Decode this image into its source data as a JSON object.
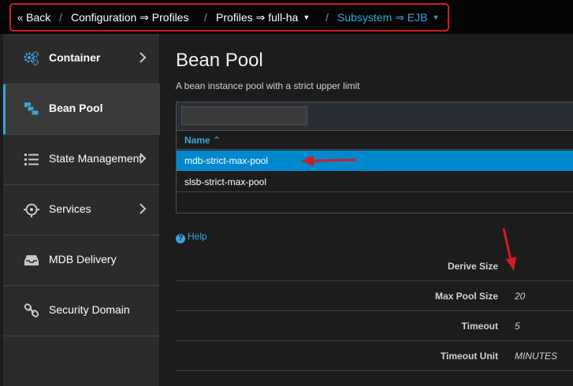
{
  "breadcrumb": {
    "back": "Back",
    "configuration": "Configuration ⇒ Profiles",
    "profiles": "Profiles ⇒ full-ha",
    "subsystem": "Subsystem ⇒ EJB",
    "separator": "/"
  },
  "sidebar": {
    "items": [
      {
        "label": "Container",
        "icon": "gears-icon"
      },
      {
        "label": "Bean Pool",
        "icon": "bean-pool-icon"
      },
      {
        "label": "State Management",
        "icon": "list-icon"
      },
      {
        "label": "Services",
        "icon": "services-icon"
      },
      {
        "label": "MDB Delivery",
        "icon": "inbox-icon"
      },
      {
        "label": "Security Domain",
        "icon": "link-icon"
      }
    ]
  },
  "main": {
    "title": "Bean Pool",
    "description": "A bean instance pool with a strict upper limit",
    "filter_value": "",
    "column_header": "Name ⌃",
    "rows": [
      "mdb-strict-max-pool",
      "slsb-strict-max-pool"
    ],
    "help": "Help",
    "attributes": [
      {
        "label": "Derive Size",
        "value": ""
      },
      {
        "label": "Max Pool Size",
        "value": "20"
      },
      {
        "label": "Timeout",
        "value": "5"
      },
      {
        "label": "Timeout Unit",
        "value": "MINUTES"
      }
    ]
  },
  "colors": {
    "accent": "#39a5dc",
    "selected_row": "#0088ce",
    "annotation": "#d21d24"
  }
}
